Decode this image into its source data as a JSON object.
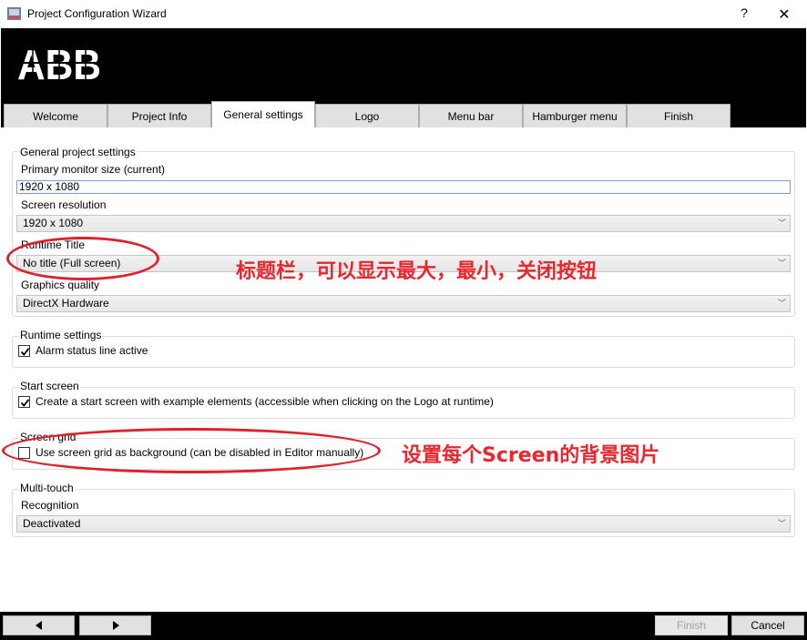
{
  "window": {
    "title": "Project Configuration Wizard",
    "help_glyph": "?",
    "close_glyph": "✕"
  },
  "brand": {
    "logo_text": "ABB",
    "header_color": "#000000"
  },
  "tabs": [
    {
      "label": "Welcome"
    },
    {
      "label": "Project Info"
    },
    {
      "label": "General settings",
      "active": true
    },
    {
      "label": "Logo"
    },
    {
      "label": "Menu bar"
    },
    {
      "label": "Hamburger menu"
    },
    {
      "label": "Finish"
    }
  ],
  "general": {
    "title": "General project settings",
    "monitor_label": "Primary monitor size (current)",
    "monitor_value": "1920 x 1080",
    "resolution_label": "Screen resolution",
    "resolution_value": "1920 x 1080",
    "runtime_title_label": "Runtime Title",
    "runtime_title_value": "No title (Full screen)",
    "graphics_label": "Graphics quality",
    "graphics_value": "DirectX Hardware"
  },
  "runtime": {
    "title": "Runtime settings",
    "alarm_label": "Alarm status line active",
    "alarm_checked": true
  },
  "start_screen": {
    "title": "Start screen",
    "create_label": "Create a start screen with example elements (accessible when clicking on the Logo at runtime)",
    "create_checked": true
  },
  "screen_grid": {
    "title": "Screen grid",
    "grid_label": "Use screen grid as background (can be disabled in Editor manually)",
    "grid_checked": false
  },
  "multitouch": {
    "title": "Multi-touch",
    "recognition_label": "Recognition",
    "recognition_value": "Deactivated"
  },
  "annotations": {
    "title_bar_note": "标题栏，可以显示最大，最小，关闭按钮",
    "grid_note": "设置每个Screen的背景图片",
    "color": "#e8272f"
  },
  "footer": {
    "finish_label": "Finish",
    "finish_enabled": false,
    "cancel_label": "Cancel"
  }
}
